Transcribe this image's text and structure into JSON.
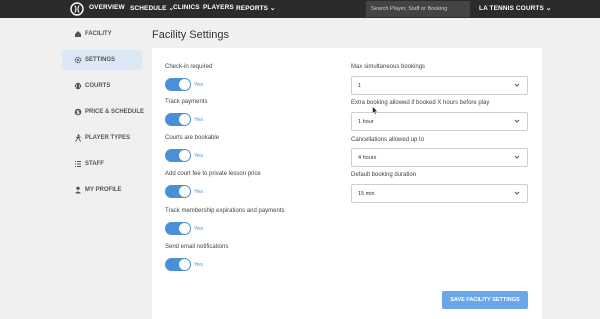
{
  "nav": {
    "items": [
      {
        "label": "OVERVIEW"
      },
      {
        "label": "SCHEDULE ⌄"
      },
      {
        "label": "CLINICS"
      },
      {
        "label": "PLAYERS"
      },
      {
        "label": "REPORTS ⌄"
      }
    ],
    "search_placeholder": "Search Player, Staff or Booking",
    "club": "LA TENNIS COURTS ⌄"
  },
  "sidebar": {
    "items": [
      {
        "label": "FACILITY",
        "icon": "home-icon"
      },
      {
        "label": "SETTINGS",
        "icon": "gear-icon",
        "active": true
      },
      {
        "label": "COURTS",
        "icon": "tennis-ball-icon"
      },
      {
        "label": "PRICE & SCHEDULE",
        "icon": "dollar-icon"
      },
      {
        "label": "PLAYER TYPES",
        "icon": "player-icon"
      },
      {
        "label": "STAFF",
        "icon": "list-icon"
      },
      {
        "label": "MY PROFILE",
        "icon": "user-icon"
      }
    ]
  },
  "page": {
    "title": "Facility Settings"
  },
  "toggles": [
    {
      "label": "Check-in required",
      "state": "Yes"
    },
    {
      "label": "Track payments",
      "state": "Yes"
    },
    {
      "label": "Courts are bookable",
      "state": "Yes"
    },
    {
      "label": "Add court fee to private lesson price",
      "state": "Yes"
    },
    {
      "label": "Track membership expirations and payments",
      "state": "Yes"
    },
    {
      "label": "Send email notifications",
      "state": "Yes"
    }
  ],
  "selects": [
    {
      "label": "Max simultaneous bookings",
      "value": "1"
    },
    {
      "label": "Extra booking allowed if booked X hours before play",
      "value": "1 hour"
    },
    {
      "label": "Cancellations allowed up to",
      "value": "4 hours"
    },
    {
      "label": "Default booking duration",
      "value": "15 min"
    }
  ],
  "save_label": "SAVE FACILITY SETTINGS",
  "colors": {
    "topbar": "#2b2b2b",
    "accent": "#4a90d9",
    "button": "#6aa6e8",
    "sidebar_active": "#dbe8f6"
  }
}
